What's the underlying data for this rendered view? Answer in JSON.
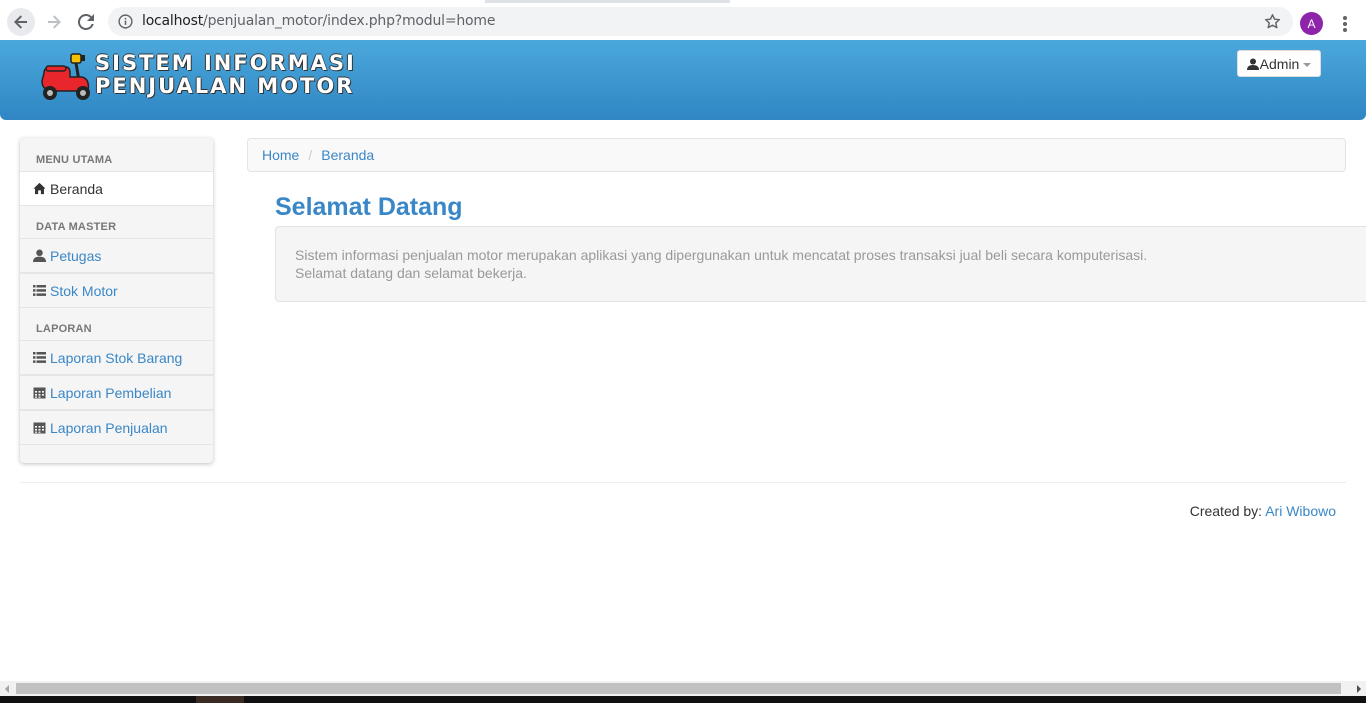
{
  "browser": {
    "url_host": "localhost",
    "url_path": "/penjualan_motor/index.php?modul=home",
    "avatar_letter": "A"
  },
  "header": {
    "brand_line1": "SISTEM INFORMASI",
    "brand_line2": "PENJUALAN MOTOR",
    "user_label": "Admin"
  },
  "sidebar": {
    "sections": [
      {
        "title": "MENU UTAMA"
      },
      {
        "title": "DATA MASTER"
      },
      {
        "title": "LAPORAN"
      }
    ],
    "items": [
      {
        "label": "Beranda",
        "icon": "home-icon"
      },
      {
        "label": "Petugas",
        "icon": "user-icon"
      },
      {
        "label": "Stok Motor",
        "icon": "list-icon"
      },
      {
        "label": "Laporan Stok Barang",
        "icon": "list-icon"
      },
      {
        "label": "Laporan Pembelian",
        "icon": "calendar-icon"
      },
      {
        "label": "Laporan Penjualan",
        "icon": "calendar-icon"
      }
    ]
  },
  "breadcrumb": {
    "items": [
      "Home",
      "Beranda"
    ],
    "separator": "/"
  },
  "main": {
    "title": "Selamat Datang",
    "line1": "Sistem informasi penjualan motor merupakan aplikasi yang dipergunakan untuk mencatat proses transaksi jual beli secara komputerisasi.",
    "line2": "Selamat datang dan selamat bekerja."
  },
  "footer": {
    "prefix": "Created by:",
    "author": "Ari Wibowo"
  },
  "colors": {
    "accent": "#3a87c7",
    "header_top": "#4ba8dc",
    "header_bottom": "#2f86c3",
    "muted_text": "#999999"
  }
}
